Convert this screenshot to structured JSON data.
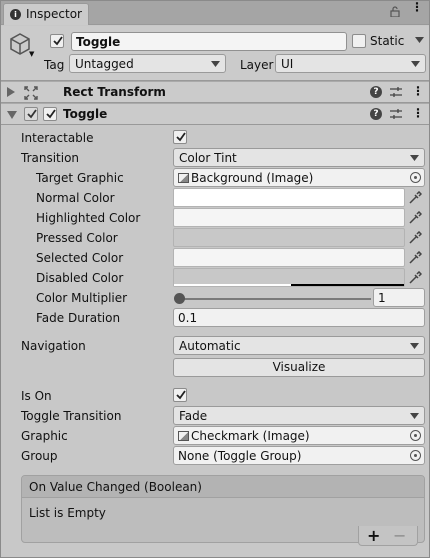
{
  "tab": {
    "title": "Inspector"
  },
  "gameobject": {
    "active": true,
    "name": "Toggle",
    "static_label": "Static",
    "static_checked": false,
    "tag_label": "Tag",
    "tag_value": "Untagged",
    "layer_label": "Layer",
    "layer_value": "UI"
  },
  "components": {
    "rect_transform": {
      "title": "Rect Transform",
      "expanded": false
    },
    "toggle": {
      "title": "Toggle",
      "expanded": true,
      "enabled": true
    }
  },
  "toggle": {
    "interactable_label": "Interactable",
    "interactable": true,
    "transition_label": "Transition",
    "transition_value": "Color Tint",
    "target_graphic_label": "Target Graphic",
    "target_graphic_value": "Background (Image)",
    "normal_color_label": "Normal Color",
    "highlighted_color_label": "Highlighted Color",
    "pressed_color_label": "Pressed Color",
    "selected_color_label": "Selected Color",
    "disabled_color_label": "Disabled Color",
    "color_multiplier_label": "Color Multiplier",
    "color_multiplier_value": "1",
    "fade_duration_label": "Fade Duration",
    "fade_duration_value": "0.1",
    "navigation_label": "Navigation",
    "navigation_value": "Automatic",
    "visualize_label": "Visualize",
    "is_on_label": "Is On",
    "is_on": true,
    "toggle_transition_label": "Toggle Transition",
    "toggle_transition_value": "Fade",
    "graphic_label": "Graphic",
    "graphic_value": "Checkmark (Image)",
    "group_label": "Group",
    "group_value": "None (Toggle Group)"
  },
  "colors": {
    "normal": "#FFFFFF",
    "highlighted": "#F5F5F5",
    "pressed": "#C8C8C8",
    "selected": "#F5F5F5",
    "disabled": "#C8C8C8"
  },
  "event": {
    "title": "On Value Changed (Boolean)",
    "empty_text": "List is Empty",
    "add_label": "+",
    "remove_label": "−"
  }
}
